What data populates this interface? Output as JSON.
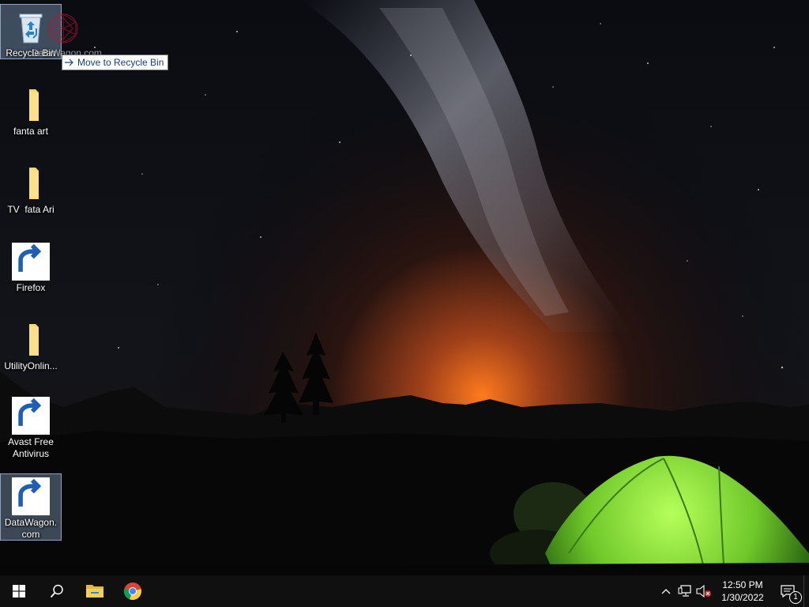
{
  "desktop": {
    "icons": [
      {
        "label": "Recycle Bin",
        "icon": "recycle-bin-icon",
        "selected": true,
        "shortcut": false
      },
      {
        "label": "fanta art",
        "icon": "folder-icon",
        "selected": false,
        "shortcut": false
      },
      {
        "label": "TV  fata Ari",
        "icon": "folder-icon",
        "selected": false,
        "shortcut": false
      },
      {
        "label": "Firefox",
        "icon": "firefox-icon",
        "selected": false,
        "shortcut": true
      },
      {
        "label": "UtilityOnlin...",
        "icon": "folder-icon",
        "selected": false,
        "shortcut": false
      },
      {
        "label": "Avast Free Antivirus",
        "icon": "avast-icon",
        "selected": false,
        "shortcut": true
      },
      {
        "label": "DataWagon.com",
        "icon": "datawagon-icon",
        "selected": true,
        "shortcut": true
      }
    ],
    "drag_ghost_label": "DataWagon.com",
    "drop_tooltip": "Move to Recycle Bin"
  },
  "taskbar": {
    "buttons": [
      {
        "name": "start",
        "icon": "windows-logo-icon"
      },
      {
        "name": "search",
        "icon": "search-icon"
      },
      {
        "name": "file-explorer",
        "icon": "file-explorer-icon"
      },
      {
        "name": "chrome",
        "icon": "chrome-icon"
      }
    ],
    "tray": {
      "icons": [
        "chevron-up-icon",
        "network-icon",
        "volume-muted-icon"
      ],
      "time": "12:50 PM",
      "date": "1/30/2022",
      "notification_count": "1"
    }
  },
  "colors": {
    "taskbar": "#101010",
    "tooltip_text": "#1a3e7a",
    "selection": "#96b4d7",
    "tent": "#7fd63a",
    "horizon_glow": "#e8651c"
  }
}
